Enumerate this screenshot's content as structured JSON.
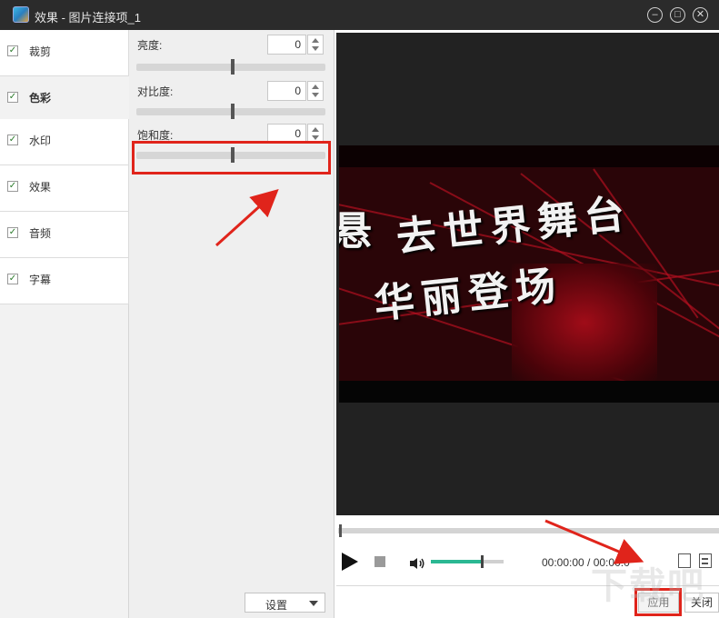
{
  "window": {
    "title": "效果 - 图片连接项_1",
    "controls": {
      "minimize": "–",
      "maximize": "□",
      "close": "✕"
    }
  },
  "sidebar": {
    "items": [
      {
        "label": "裁剪",
        "checked": true,
        "active": false
      },
      {
        "label": "色彩",
        "checked": true,
        "active": true
      },
      {
        "label": "水印",
        "checked": true,
        "active": false
      },
      {
        "label": "效果",
        "checked": true,
        "active": false
      },
      {
        "label": "音频",
        "checked": true,
        "active": false
      },
      {
        "label": "字幕",
        "checked": true,
        "active": false
      }
    ],
    "check_glyph": "✓"
  },
  "color_panel": {
    "brightness": {
      "label": "亮度:",
      "value": "0"
    },
    "contrast": {
      "label": "对比度:",
      "value": "0"
    },
    "saturation": {
      "label": "饱和度:",
      "value": "0"
    },
    "settings_button": "设置"
  },
  "preview": {
    "caption_line1": "去世界舞台",
    "caption_line2": "华丽登场",
    "caption_edge": "悬"
  },
  "player": {
    "time": "00:00:00 / 00:00:0"
  },
  "footer": {
    "apply_button": "应用",
    "close_button": "关闭"
  },
  "watermark": "下载吧",
  "colors": {
    "titlebar": "#2b2b2b",
    "highlight": "#e0241b",
    "volume_fill": "#2bb893"
  }
}
